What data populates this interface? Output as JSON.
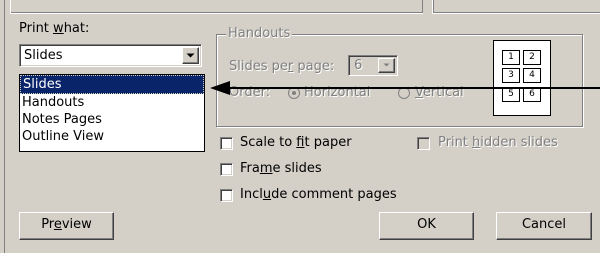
{
  "print_what": {
    "label_prefix": "Print ",
    "label_mnemonic": "w",
    "label_suffix": "hat:",
    "selected_value": "Slides",
    "options": [
      "Slides",
      "Handouts",
      "Notes Pages",
      "Outline View"
    ],
    "highlighted_index": 0
  },
  "handouts": {
    "title": "Handouts",
    "slides_per_page_label_a": "Slides pe",
    "slides_per_page_label_mn": "r",
    "slides_per_page_label_b": " page:",
    "slides_per_page_value": "6",
    "order_label": "Order:",
    "order_horizontal": "Horizontal",
    "order_vertical_mn": "V",
    "order_vertical_rest": "ertical",
    "preview_pages": [
      "1",
      "2",
      "3",
      "4",
      "5",
      "6"
    ]
  },
  "options": {
    "scale_a": "Scale to ",
    "scale_mn": "f",
    "scale_b": "it paper",
    "frame_a": "Fra",
    "frame_mn": "m",
    "frame_b": "e slides",
    "comment_a": "Incl",
    "comment_mn": "u",
    "comment_b": "de comment pages",
    "hidden_a": "Print ",
    "hidden_mn": "h",
    "hidden_b": "idden slides"
  },
  "buttons": {
    "preview_a": "Pr",
    "preview_mn": "e",
    "preview_b": "view",
    "ok": "OK",
    "cancel": "Cancel"
  }
}
